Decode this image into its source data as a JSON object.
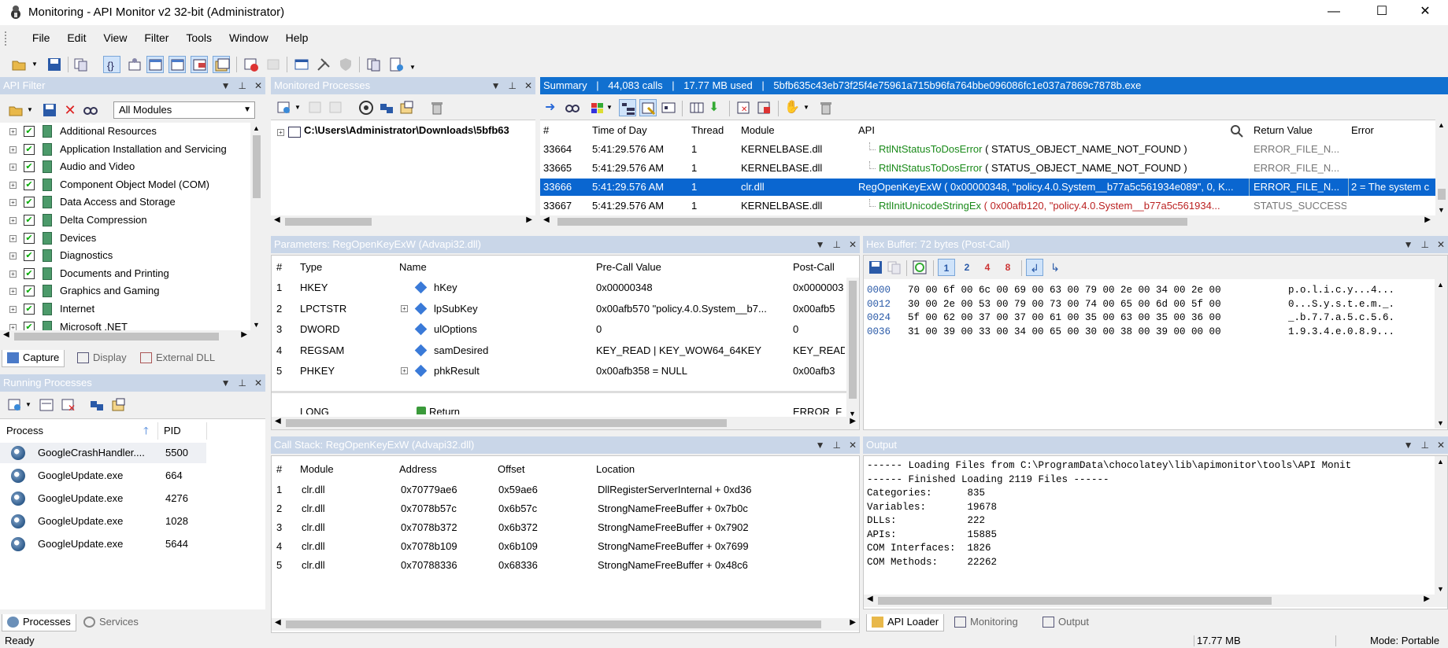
{
  "window": {
    "title": "Monitoring - API Monitor v2 32-bit (Administrator)",
    "controls": [
      "—",
      "☐",
      "✕"
    ]
  },
  "menu": [
    "File",
    "Edit",
    "View",
    "Filter",
    "Tools",
    "Window",
    "Help"
  ],
  "toolbar_icons": [
    "open-icon",
    "save-icon",
    "copy-icon",
    "filter-icon",
    "process-icon",
    "layout1-icon",
    "layout2-icon",
    "layout3-icon",
    "layout4-icon",
    "stop-icon",
    "attach-icon",
    "window-icon",
    "tools-icon",
    "shield-icon",
    "copy2-icon",
    "export-icon"
  ],
  "api_filter": {
    "title": "API Filter",
    "module_select": "All Modules",
    "items": [
      "Additional Resources",
      "Application Installation and Servicing",
      "Audio and Video",
      "Component Object Model (COM)",
      "Data Access and Storage",
      "Delta Compression",
      "Devices",
      "Diagnostics",
      "Documents and Printing",
      "Graphics and Gaming",
      "Internet",
      "Microsoft .NET"
    ],
    "tabs": [
      "Capture",
      "Display",
      "External DLL"
    ]
  },
  "running_processes": {
    "title": "Running Processes",
    "columns": [
      "Process",
      "PID"
    ],
    "rows": [
      {
        "name": "GoogleCrashHandler....",
        "pid": "5500"
      },
      {
        "name": "GoogleUpdate.exe",
        "pid": "664"
      },
      {
        "name": "GoogleUpdate.exe",
        "pid": "4276"
      },
      {
        "name": "GoogleUpdate.exe",
        "pid": "1028"
      },
      {
        "name": "GoogleUpdate.exe",
        "pid": "5644"
      }
    ],
    "tabs": [
      "Processes",
      "Services"
    ]
  },
  "monitored_processes": {
    "title": "Monitored Processes",
    "path": "C:\\Users\\Administrator\\Downloads\\5bfb63"
  },
  "summary": {
    "title": "Summary",
    "calls": "44,083 calls",
    "memory": "17.77 MB used",
    "exe": "5bfb635c43eb73f25f4e75961a715b96fa764bbe096086fc1e037a7869c7878b.exe",
    "columns": [
      "#",
      "Time of Day",
      "Thread",
      "Module",
      "API",
      "Return Value",
      "Error"
    ],
    "rows": [
      {
        "n": "33664",
        "time": "5:41:29.576 AM",
        "thread": "1",
        "module": "KERNELBASE.dll",
        "api_name": "RtlNtStatusToDosError",
        "api_args": " ( STATUS_OBJECT_NAME_NOT_FOUND )",
        "ret": "ERROR_FILE_N...",
        "err": ""
      },
      {
        "n": "33665",
        "time": "5:41:29.576 AM",
        "thread": "1",
        "module": "KERNELBASE.dll",
        "api_name": "RtlNtStatusToDosError",
        "api_args": " ( STATUS_OBJECT_NAME_NOT_FOUND )",
        "ret": "ERROR_FILE_N...",
        "err": ""
      },
      {
        "n": "33666",
        "time": "5:41:29.576 AM",
        "thread": "1",
        "module": "clr.dll",
        "api_name": "RegOpenKeyExW",
        "api_args": " ( 0x00000348, \"policy.4.0.System__b77a5c561934e089\", 0, K...",
        "ret": "ERROR_FILE_N...",
        "err": "2 = The system c"
      },
      {
        "n": "33667",
        "time": "5:41:29.576 AM",
        "thread": "1",
        "module": "KERNELBASE.dll",
        "api_name": "RtlInitUnicodeStringEx",
        "api_args": " ( 0x00afb120, \"policy.4.0.System__b77a5c561934...",
        "ret": "STATUS_SUCCESS",
        "err": ""
      }
    ]
  },
  "parameters": {
    "title": "Parameters: RegOpenKeyExW (Advapi32.dll)",
    "columns": [
      "#",
      "Type",
      "Name",
      "Pre-Call Value",
      "Post-Call"
    ],
    "rows": [
      {
        "n": "1",
        "type": "HKEY",
        "name": "hKey",
        "pre": "0x00000348",
        "post": "0x0000003",
        "expand": false
      },
      {
        "n": "2",
        "type": "LPCTSTR",
        "name": "lpSubKey",
        "pre": "0x00afb570 \"policy.4.0.System__b7...",
        "post": "0x00afb5",
        "expand": true
      },
      {
        "n": "3",
        "type": "DWORD",
        "name": "ulOptions",
        "pre": "0",
        "post": "0",
        "expand": false
      },
      {
        "n": "4",
        "type": "REGSAM",
        "name": "samDesired",
        "pre": "KEY_READ | KEY_WOW64_64KEY",
        "post": "KEY_READ",
        "expand": false
      },
      {
        "n": "5",
        "type": "PHKEY",
        "name": "phkResult",
        "pre": "0x00afb358 = NULL",
        "post": "0x00afb3",
        "expand": true
      }
    ],
    "return_row": {
      "type": "LONG",
      "name": "Return",
      "post": "ERROR_F"
    }
  },
  "hex_buffer": {
    "title": "Hex Buffer: 72 bytes (Post-Call)",
    "tool_labels": [
      "1",
      "2",
      "4",
      "8"
    ],
    "rows": [
      {
        "off": "0000",
        "hex": "70 00 6f 00 6c 00 69 00 63 00 79 00 2e 00 34 00 2e 00",
        "ascii": "p.o.l.i.c.y...4..."
      },
      {
        "off": "0012",
        "hex": "30 00 2e 00 53 00 79 00 73 00 74 00 65 00 6d 00 5f 00",
        "ascii": "0...S.y.s.t.e.m._."
      },
      {
        "off": "0024",
        "hex": "5f 00 62 00 37 00 37 00 61 00 35 00 63 00 35 00 36 00",
        "ascii": "_.b.7.7.a.5.c.5.6."
      },
      {
        "off": "0036",
        "hex": "31 00 39 00 33 00 34 00 65 00 30 00 38 00 39 00 00 00",
        "ascii": "1.9.3.4.e.0.8.9..."
      }
    ]
  },
  "call_stack": {
    "title": "Call Stack: RegOpenKeyExW (Advapi32.dll)",
    "columns": [
      "#",
      "Module",
      "Address",
      "Offset",
      "Location"
    ],
    "rows": [
      {
        "n": "1",
        "module": "clr.dll",
        "addr": "0x70779ae6",
        "off": "0x59ae6",
        "loc": "DllRegisterServerInternal + 0xd36"
      },
      {
        "n": "2",
        "module": "clr.dll",
        "addr": "0x7078b57c",
        "off": "0x6b57c",
        "loc": "StrongNameFreeBuffer + 0x7b0c"
      },
      {
        "n": "3",
        "module": "clr.dll",
        "addr": "0x7078b372",
        "off": "0x6b372",
        "loc": "StrongNameFreeBuffer + 0x7902"
      },
      {
        "n": "4",
        "module": "clr.dll",
        "addr": "0x7078b109",
        "off": "0x6b109",
        "loc": "StrongNameFreeBuffer + 0x7699"
      },
      {
        "n": "5",
        "module": "clr.dll",
        "addr": "0x70788336",
        "off": "0x68336",
        "loc": "StrongNameFreeBuffer + 0x48c6"
      }
    ]
  },
  "output": {
    "title": "Output",
    "lines": [
      "------ Loading Files from C:\\ProgramData\\chocolatey\\lib\\apimonitor\\tools\\API Monit",
      "------ Finished Loading 2119 Files ------",
      "Categories:      835",
      "Variables:       19678",
      "DLLs:            222",
      "APIs:            15885",
      "COM Interfaces:  1826",
      "COM Methods:     22262"
    ],
    "tabs": [
      "API Loader",
      "Monitoring",
      "Output"
    ]
  },
  "status": {
    "left": "Ready",
    "memory": "17.77 MB",
    "mode": "Mode: Portable"
  },
  "colors": {
    "active_header": "#1170d0",
    "inactive_header": "#c9d6e8",
    "selection": "#0a66d0",
    "api_green": "#1a8a1a"
  }
}
